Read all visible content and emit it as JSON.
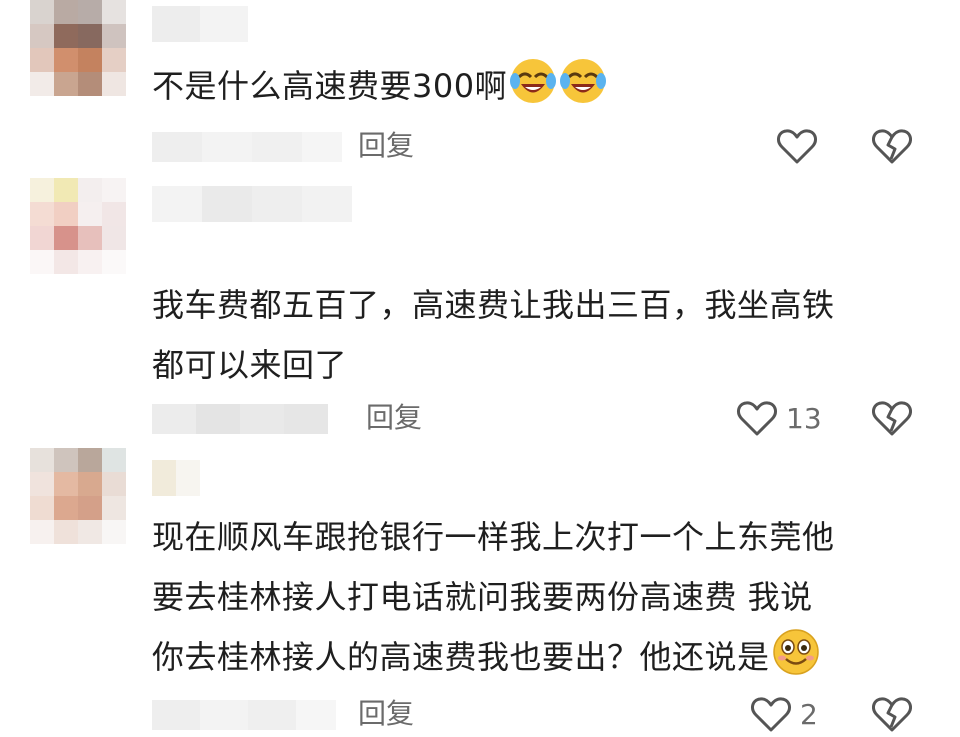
{
  "comments": [
    {
      "text": "不是什么高速费要300啊",
      "reply_label": "回复",
      "like_count": "",
      "emojis": [
        "laughing-crying-emoji",
        "laughing-crying-emoji"
      ]
    },
    {
      "text_lines": [
        "我车费都五百了，高速费让我出三百，我坐高铁",
        "都可以来回了"
      ],
      "reply_label": "回复",
      "like_count": "13"
    },
    {
      "text_lines": [
        "现在顺风车跟抢银行一样我上次打一个上东莞他",
        "要去桂林接人打电话就问我要两份高速费 我说",
        "你去桂林接人的高速费我也要出？他还说是"
      ],
      "reply_label": "回复",
      "like_count": "2",
      "emojis": [
        "smiling-face-emoji"
      ]
    }
  ],
  "icons": {
    "like": "heart-outline-icon",
    "dislike": "broken-heart-icon"
  },
  "colors": {
    "text": "#1f1f1f",
    "meta": "#6b6b6b",
    "icon": "#555555",
    "emoji_yellow": "#f7c53a"
  }
}
